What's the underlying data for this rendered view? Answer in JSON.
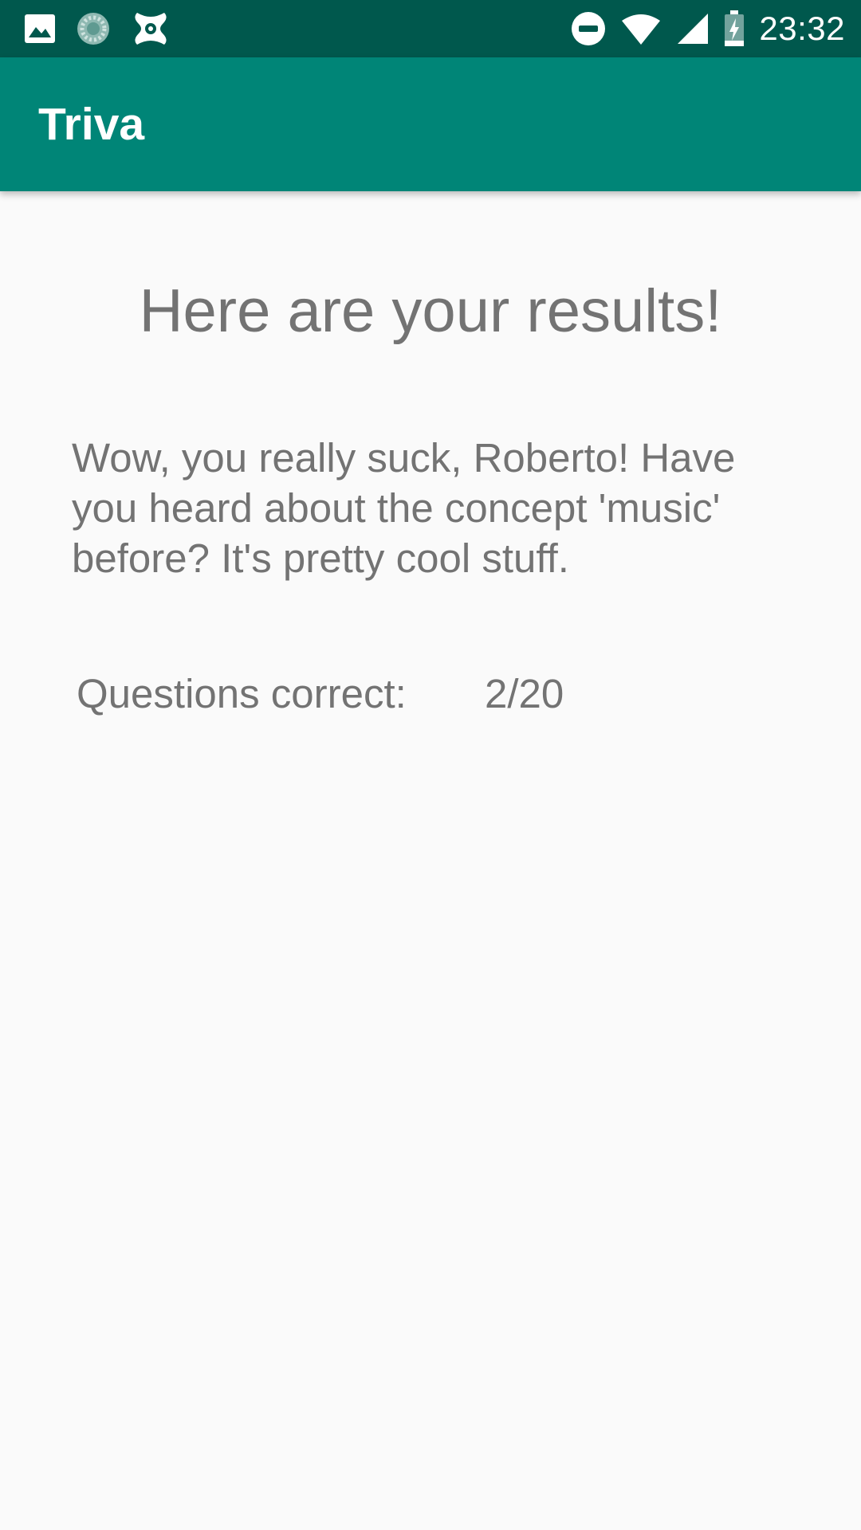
{
  "status_bar": {
    "left_icons": [
      "image-icon",
      "loading-circle-icon",
      "app-notification-icon"
    ],
    "right_icons": [
      "do-not-disturb-icon",
      "wifi-icon",
      "cell-signal-icon",
      "battery-charging-icon"
    ],
    "time": "23:32"
  },
  "app_bar": {
    "title": "Triva"
  },
  "results": {
    "heading": "Here are your results!",
    "message": "Wow, you really suck, Roberto! Have you heard about the concept 'music' before? It's pretty cool stuff.",
    "score_label": "Questions correct:",
    "score_value": "2/20"
  },
  "colors": {
    "status_bar": "#00584d",
    "app_bar": "#008577",
    "background": "#fafafa",
    "text": "#737373"
  }
}
